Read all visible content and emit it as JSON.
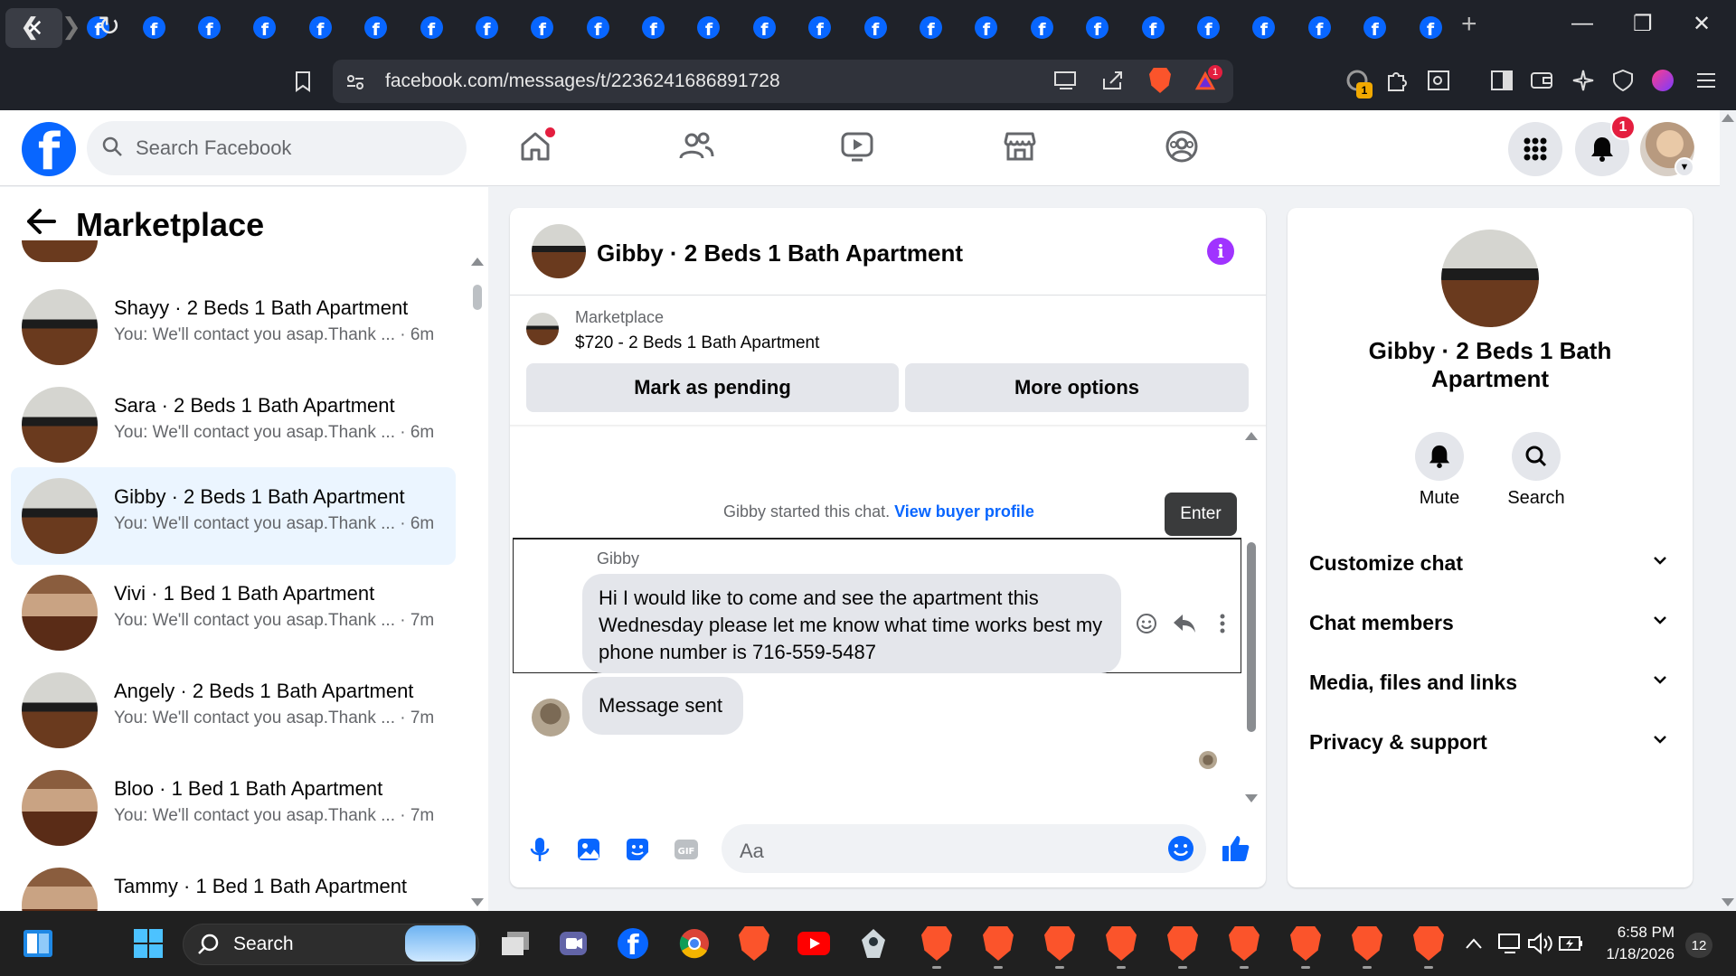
{
  "browser": {
    "close_tab_glyph": "✕",
    "tab_favicon_letter": "f",
    "tab_count": 25,
    "url": "facebook.com/messages/t/2236241686891728",
    "extension_badge": "1",
    "other_badge": "1"
  },
  "header": {
    "logo_letter": "f",
    "search_placeholder": "Search Facebook",
    "notification_count": "1",
    "icons": [
      "home-icon",
      "friends-icon",
      "video-icon",
      "marketplace-icon",
      "groups-icon"
    ]
  },
  "left": {
    "title": "Marketplace",
    "conversations": [
      {
        "name": "Shayy · 2 Beds 1 Bath Apartment",
        "preview": "You: We'll contact you asap.Thank ... · 6m"
      },
      {
        "name": "Sara · 2 Beds 1 Bath Apartment",
        "preview": "You: We'll contact you asap.Thank ... · 6m"
      },
      {
        "name": "Gibby · 2 Beds 1 Bath Apartment",
        "preview": "You: We'll contact you asap.Thank ... · 6m"
      },
      {
        "name": "Vivi · 1 Bed 1 Bath Apartment",
        "preview": "You: We'll contact you asap.Thank ... · 7m"
      },
      {
        "name": "Angely · 2 Beds 1 Bath Apartment",
        "preview": "You: We'll contact you asap.Thank ... · 7m"
      },
      {
        "name": "Bloo · 1 Bed 1 Bath Apartment",
        "preview": "You: We'll contact you asap.Thank ... · 7m"
      },
      {
        "name": "Tammy · 1 Bed 1 Bath Apartment",
        "preview": ""
      }
    ]
  },
  "chat": {
    "title": "Gibby · 2 Beds 1 Bath Apartment",
    "listing_category": "Marketplace",
    "listing_price": "$720 - 2 Beds 1 Bath Apartment",
    "mark_pending": "Mark as pending",
    "more_options": "More options",
    "started_text": "Gibby started this chat.",
    "view_profile": "View buyer profile",
    "tooltip": "Enter",
    "sender": "Gibby",
    "message": "Hi I would like to come and see the apartment this Wednesday please let me know what time works best my phone number is 716-559-5487",
    "sent_message": "Message sent",
    "composer_placeholder": "Aa"
  },
  "right": {
    "name": "Gibby · 2 Beds 1 Bath Apartment",
    "mute_label": "Mute",
    "search_label": "Search",
    "sections": [
      "Customize chat",
      "Chat members",
      "Media, files and links",
      "Privacy & support"
    ]
  },
  "taskbar": {
    "search_label": "Search",
    "time": "6:58 PM",
    "date": "1/18/2026",
    "notif_count": "12"
  },
  "colors": {
    "fb_blue": "#0866ff",
    "active_conv": "#ebf5ff",
    "badge_red": "#e41e3f",
    "info_purple": "#a033ff",
    "brave_orange": "#fb542b"
  }
}
